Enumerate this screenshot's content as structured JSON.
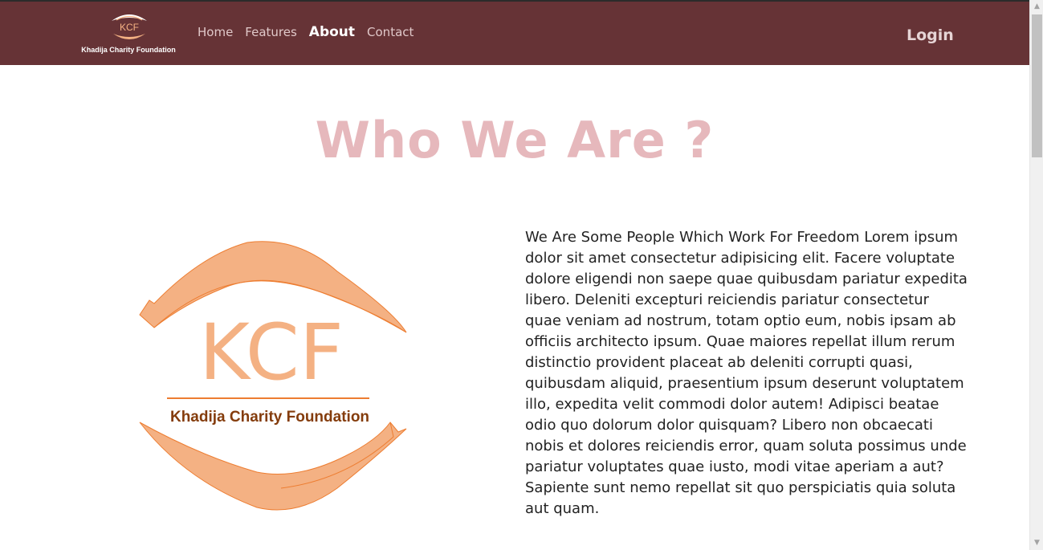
{
  "navbar": {
    "brand_text": "Khadija Charity Foundation",
    "links": [
      {
        "label": "Home"
      },
      {
        "label": "Features"
      },
      {
        "label": "About"
      },
      {
        "label": "Contact"
      }
    ],
    "login_label": "Login",
    "background_color": "#663336"
  },
  "main": {
    "title": "Who We Are ?",
    "logo": {
      "initials": "KCF",
      "name": "Khadija Charity Foundation"
    },
    "about_text": "We Are Some People Which Work For Freedom Lorem ipsum dolor sit amet consectetur adipisicing elit. Facere voluptate dolore eligendi non saepe quae quibusdam pariatur expedita libero. Deleniti excepturi reiciendis pariatur consectetur quae veniam ad nostrum, totam optio eum, nobis ipsam ab officiis architecto ipsum. Quae maiores repellat illum rerum distinctio provident placeat ab deleniti corrupti quasi, quibusdam aliquid, praesentium ipsum deserunt voluptatem illo, expedita velit commodi dolor autem! Adipisci beatae odio quo dolorum dolor quisquam? Libero non obcaecati nobis et dolores reiciendis error, quam soluta possimus unde pariatur voluptates quae iusto, modi vitae aperiam a aut? Sapiente sunt nemo repellat sit quo perspiciatis quia soluta aut quam."
  },
  "colors": {
    "accent_orange": "#f4b183",
    "title_pink": "#e6b8bc",
    "logo_text_brown": "#843c0c"
  }
}
